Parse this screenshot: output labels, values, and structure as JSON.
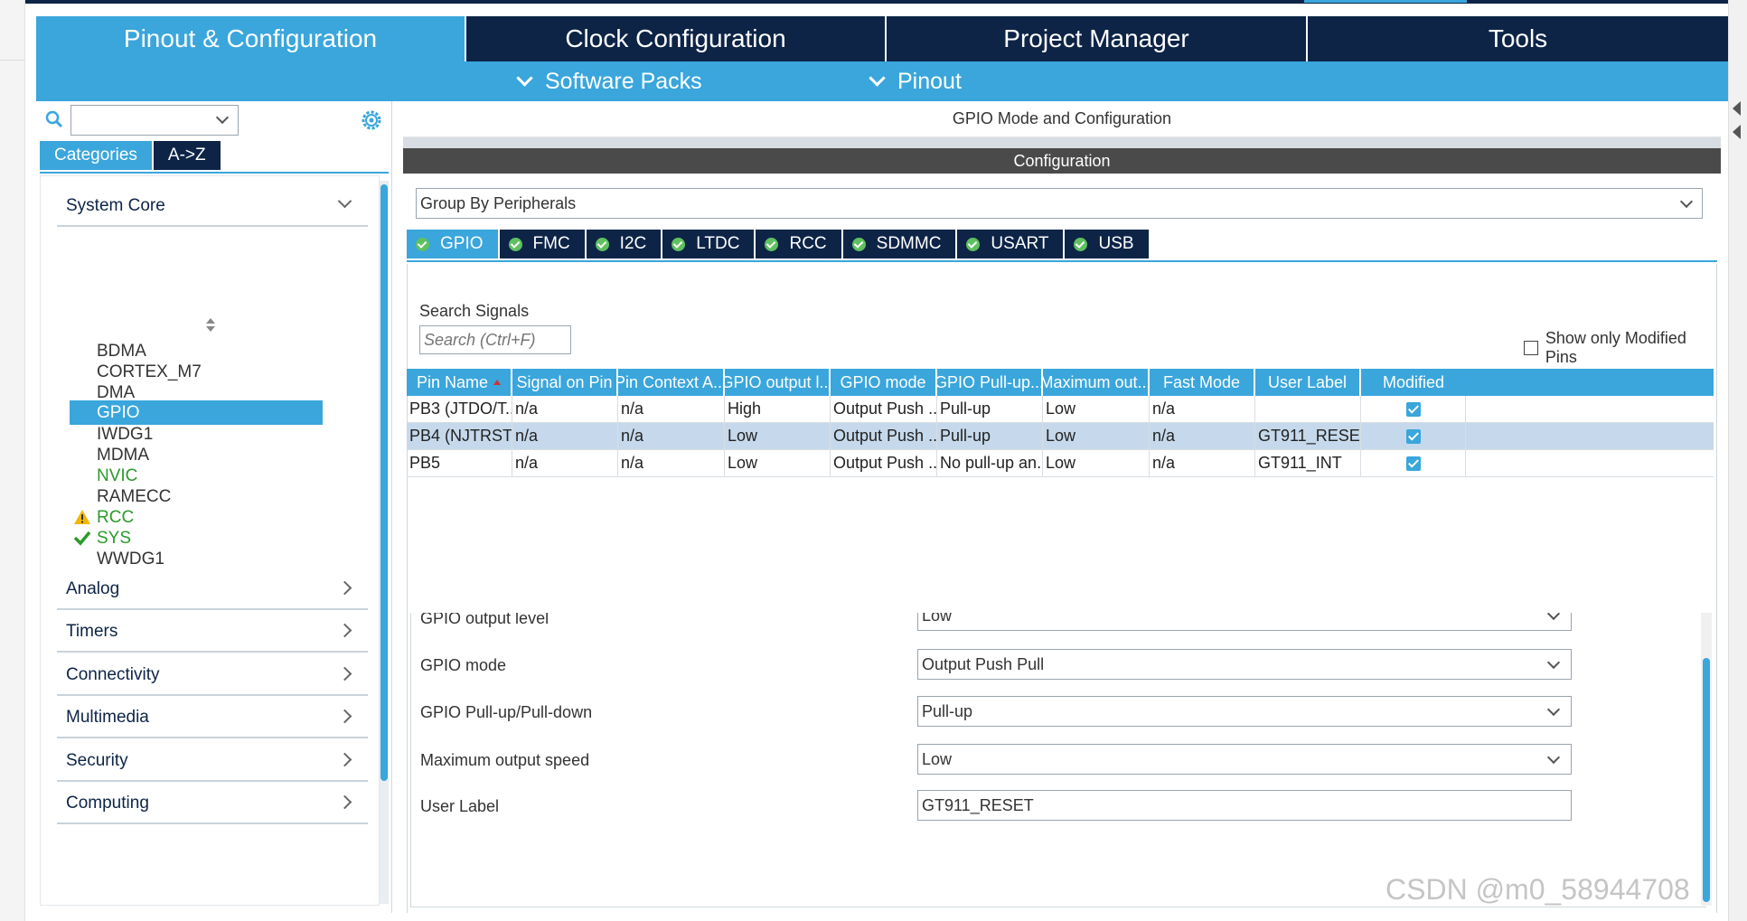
{
  "main_tabs": [
    {
      "label": "Pinout & Configuration",
      "active": true
    },
    {
      "label": "Clock Configuration",
      "active": false
    },
    {
      "label": "Project Manager",
      "active": false
    },
    {
      "label": "Tools",
      "active": false
    }
  ],
  "sub_menu": {
    "software_packs": "Software Packs",
    "pinout": "Pinout"
  },
  "sidebar": {
    "search_value": "",
    "category_tabs": [
      "Categories",
      "A->Z"
    ],
    "system_core": {
      "label": "System Core",
      "items": [
        {
          "label": "BDMA",
          "state": "normal"
        },
        {
          "label": "CORTEX_M7",
          "state": "normal"
        },
        {
          "label": "DMA",
          "state": "normal"
        },
        {
          "label": "GPIO",
          "state": "selected"
        },
        {
          "label": "IWDG1",
          "state": "normal"
        },
        {
          "label": "MDMA",
          "state": "normal"
        },
        {
          "label": "NVIC",
          "state": "green"
        },
        {
          "label": "RAMECC",
          "state": "normal"
        },
        {
          "label": "RCC",
          "state": "warning"
        },
        {
          "label": "SYS",
          "state": "ok"
        },
        {
          "label": "WWDG1",
          "state": "normal"
        }
      ]
    },
    "sections": [
      "Analog",
      "Timers",
      "Connectivity",
      "Multimedia",
      "Security",
      "Computing"
    ]
  },
  "main": {
    "title": "GPIO Mode and Configuration",
    "config_header": "Configuration",
    "group_select": "Group By Peripherals",
    "peripheral_tabs": [
      "GPIO",
      "FMC",
      "I2C",
      "LTDC",
      "RCC",
      "SDMMC",
      "USART",
      "USB"
    ],
    "search_signals_label": "Search Signals",
    "search_placeholder": "Search (Ctrl+F)",
    "show_modified": "Show only Modified Pins"
  },
  "table": {
    "columns": [
      "Pin Name",
      "Signal on Pin",
      "Pin Context A...",
      "GPIO output l...",
      "GPIO mode",
      "GPIO Pull-up...",
      "Maximum out...",
      "Fast Mode",
      "User Label",
      "Modified"
    ],
    "rows": [
      {
        "cells": [
          "PB3 (JTDO/T...",
          "n/a",
          "n/a",
          "High",
          "Output Push ...",
          "Pull-up",
          "Low",
          "n/a",
          ""
        ],
        "modified": true,
        "selected": false
      },
      {
        "cells": [
          "PB4 (NJTRST)",
          "n/a",
          "n/a",
          "Low",
          "Output Push ...",
          "Pull-up",
          "Low",
          "n/a",
          "GT911_RESET"
        ],
        "modified": true,
        "selected": true
      },
      {
        "cells": [
          "PB5",
          "n/a",
          "n/a",
          "Low",
          "Output Push ...",
          "No pull-up an...",
          "Low",
          "n/a",
          "GT911_INT"
        ],
        "modified": true,
        "selected": false
      }
    ]
  },
  "properties": [
    {
      "label": "GPIO output level",
      "value": "Low",
      "type": "select"
    },
    {
      "label": "GPIO mode",
      "value": "Output Push Pull",
      "type": "select"
    },
    {
      "label": "GPIO Pull-up/Pull-down",
      "value": "Pull-up",
      "type": "select"
    },
    {
      "label": "Maximum output speed",
      "value": "Low",
      "type": "select"
    },
    {
      "label": "User Label",
      "value": "GT911_RESET",
      "type": "text"
    }
  ],
  "watermark": "CSDN @m0_58944708",
  "colors": {
    "navy": "#0d2447",
    "accent": "#3aa6dc",
    "ok_green": "#2b9a2b",
    "warning": "#f2b705"
  }
}
